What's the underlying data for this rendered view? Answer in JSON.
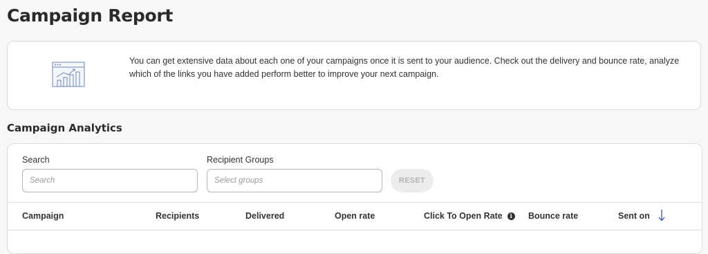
{
  "page": {
    "title": "Campaign Report"
  },
  "info": {
    "text": "You can get extensive data about each one of your campaigns once it is sent to your audience. Check out the delivery and bounce rate, analyze which of the links you have added perform better to improve your next campaign.",
    "illustration_icon": "analytics-chart-icon"
  },
  "analytics": {
    "title": "Campaign Analytics",
    "search": {
      "label": "Search",
      "placeholder": "Search",
      "value": ""
    },
    "groups": {
      "label": "Recipient Groups",
      "placeholder": "Select groups"
    },
    "reset_label": "RESET",
    "columns": [
      "Campaign",
      "Recipients",
      "Delivered",
      "Open rate",
      "Click To Open Rate",
      "Bounce rate",
      "Sent on"
    ],
    "sort_icon": "arrow-down-icon",
    "info_icon": "info-icon"
  },
  "colors": {
    "background": "#f7f7f7",
    "card": "#ffffff",
    "border": "#dcdcdc",
    "sort_accent": "#3b4fa8",
    "illustration": "#6f86b8"
  }
}
